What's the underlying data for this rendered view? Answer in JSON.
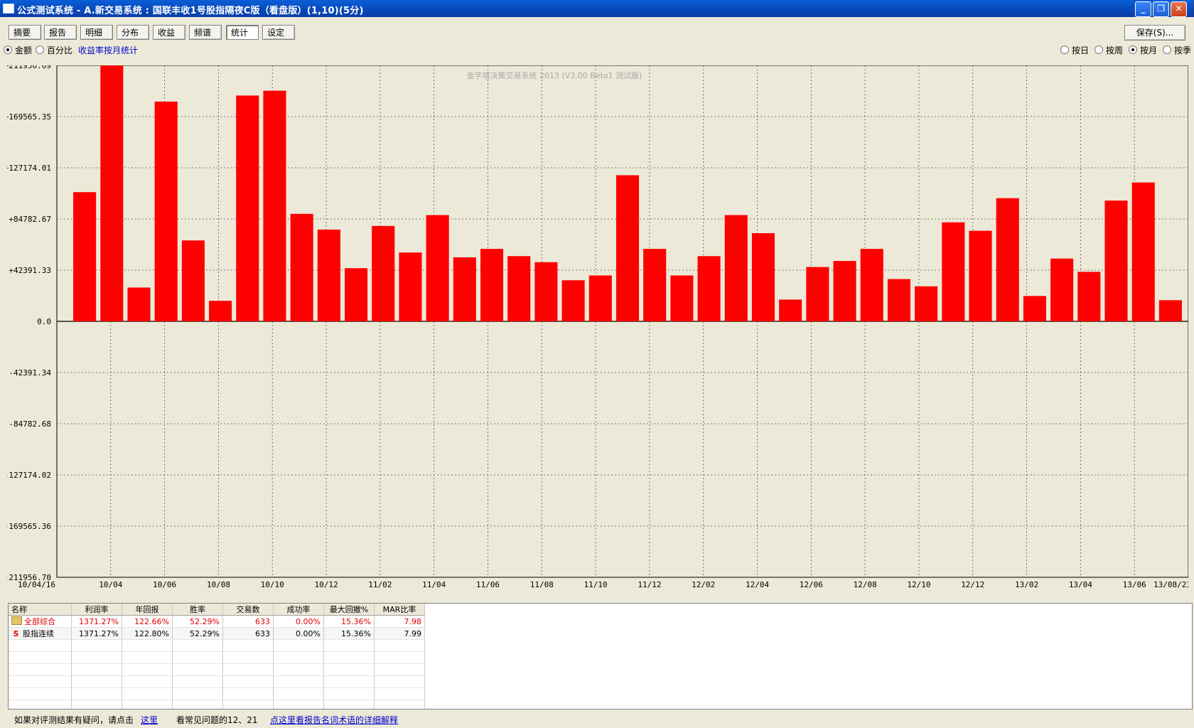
{
  "window": {
    "title": "公式测试系统 - A.新交易系统 : 国联丰收1号股指隔夜C版（看盘版）(1,10)(5分)"
  },
  "tabs": [
    {
      "label": "摘要",
      "active": false
    },
    {
      "label": "报告",
      "active": false
    },
    {
      "label": "明细",
      "active": false
    },
    {
      "label": "分布",
      "active": false
    },
    {
      "label": "收益",
      "active": false
    },
    {
      "label": "频谱",
      "active": false
    },
    {
      "label": "统计",
      "active": true
    },
    {
      "label": "设定",
      "active": false
    }
  ],
  "save_label": "保存(S)...",
  "mode_options": {
    "amount": "金额",
    "percent": "百分比",
    "note": "收益率按月统计"
  },
  "period_options": {
    "day": "按日",
    "week": "按周",
    "month": "按月",
    "quarter": "按季",
    "selected": "month"
  },
  "chart_data": {
    "type": "bar",
    "watermark": "金字塔决策交易系统 2013 (V3.00 Beta1 测试版)",
    "bar_color": "#ff0000",
    "y_ticks": [
      "+211956.69",
      "+169565.35",
      "+127174.01",
      "+84782.67",
      "+42391.33",
      "0.0",
      "-42391.34",
      "-84782.68",
      "-127174.02",
      "-169565.36",
      "-211956.70"
    ],
    "ylim": [
      -211956.7,
      211956.69
    ],
    "x_labels": [
      "10/04/16",
      "10/04",
      "10/06",
      "10/08",
      "10/10",
      "10/12",
      "11/02",
      "11/04",
      "11/06",
      "11/08",
      "11/10",
      "11/12",
      "12/02",
      "12/04",
      "12/06",
      "12/08",
      "12/10",
      "12/12",
      "13/02",
      "13/04",
      "13/06",
      "13/08/23"
    ],
    "categories": [
      "10/04",
      "10/05",
      "10/06",
      "10/07",
      "10/08",
      "10/09",
      "10/10",
      "10/11",
      "10/12",
      "11/01",
      "11/02",
      "11/03",
      "11/04",
      "11/05",
      "11/06",
      "11/07",
      "11/08",
      "11/09",
      "11/10",
      "11/11",
      "11/12",
      "12/01",
      "12/02",
      "12/03",
      "12/04",
      "12/05",
      "12/06",
      "12/07",
      "12/08",
      "12/09",
      "12/10",
      "12/11",
      "12/12",
      "13/01",
      "13/02",
      "13/03",
      "13/04",
      "13/05",
      "13/06",
      "13/07",
      "13/08"
    ],
    "values": [
      107000,
      211900,
      28000,
      182000,
      67000,
      17000,
      187000,
      191000,
      89000,
      76000,
      44000,
      79000,
      57000,
      88000,
      53000,
      60000,
      54000,
      49000,
      34000,
      38000,
      121000,
      60000,
      38000,
      54000,
      88000,
      73000,
      18000,
      45000,
      50000,
      60000,
      35000,
      29000,
      82000,
      75000,
      102000,
      21000,
      52000,
      41000,
      100000,
      115000,
      17500
    ]
  },
  "grid": {
    "columns": [
      "名称",
      "利润率",
      "年回报",
      "胜率",
      "交易数",
      "成功率",
      "最大回撤%",
      "MAR比率"
    ],
    "rows": [
      {
        "name": "全部综合",
        "icon": "folder-icon",
        "values": [
          "1371.27%",
          "122.66%",
          "52.29%",
          "633",
          "0.00%",
          "15.36%",
          "7.98"
        ]
      },
      {
        "name": "股指连续",
        "icon": "s-icon",
        "values": [
          "1371.27%",
          "122.80%",
          "52.29%",
          "633",
          "0.00%",
          "15.36%",
          "7.99"
        ]
      }
    ],
    "s_glyph": "S"
  },
  "status": {
    "prefix": "如果对评测结果有疑问，请点击",
    "here_link": "这里",
    "faq": "看常见问题的12、21",
    "glossary_link": "点这里看报告名词术语的详细解释"
  }
}
